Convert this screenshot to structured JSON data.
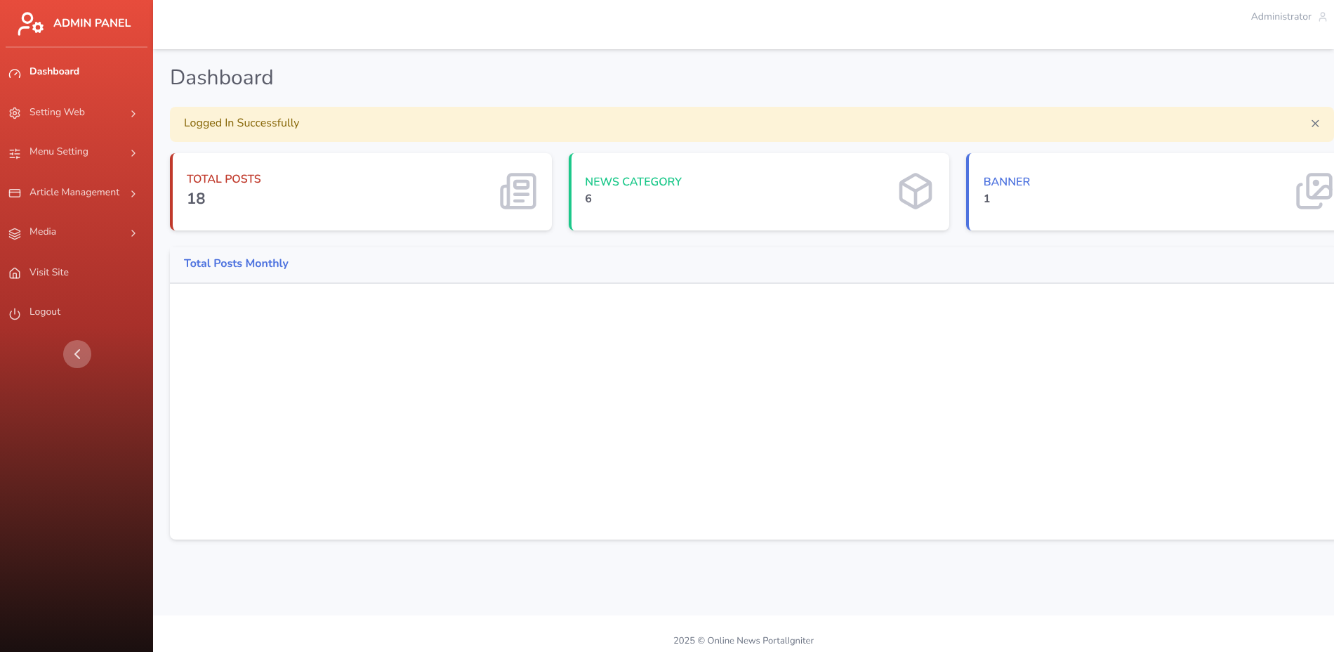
{
  "brand": {
    "title": "ADMIN PANEL"
  },
  "sidebar": {
    "items": [
      {
        "label": "Dashboard",
        "selected": true,
        "has_submenu": false
      },
      {
        "label": "Setting Web",
        "selected": false,
        "has_submenu": true
      },
      {
        "label": "Menu Setting",
        "selected": false,
        "has_submenu": true
      },
      {
        "label": "Article Management",
        "selected": false,
        "has_submenu": true
      },
      {
        "label": "Media",
        "selected": false,
        "has_submenu": true
      },
      {
        "label": "Visit Site",
        "selected": false,
        "has_submenu": false
      },
      {
        "label": "Logout",
        "selected": false,
        "has_submenu": false
      }
    ]
  },
  "topbar": {
    "user": "Administrator"
  },
  "page_title": "Dashboard",
  "alert": {
    "message": "Logged In Successfully",
    "close": "×"
  },
  "cards": [
    {
      "title": "TOTAL POSTS",
      "value": "18",
      "color": "#c0392b",
      "kind": "newspaper"
    },
    {
      "title": "NEWS CATEGORY",
      "value": "6",
      "color": "#1cc88a",
      "kind": "box"
    },
    {
      "title": "BANNER",
      "value": "1",
      "color": "#4e73df",
      "kind": "images"
    }
  ],
  "chart_panel": {
    "title": "Total Posts Monthly"
  },
  "footer": {
    "text": "2025 © Online News PortalIgniter"
  }
}
